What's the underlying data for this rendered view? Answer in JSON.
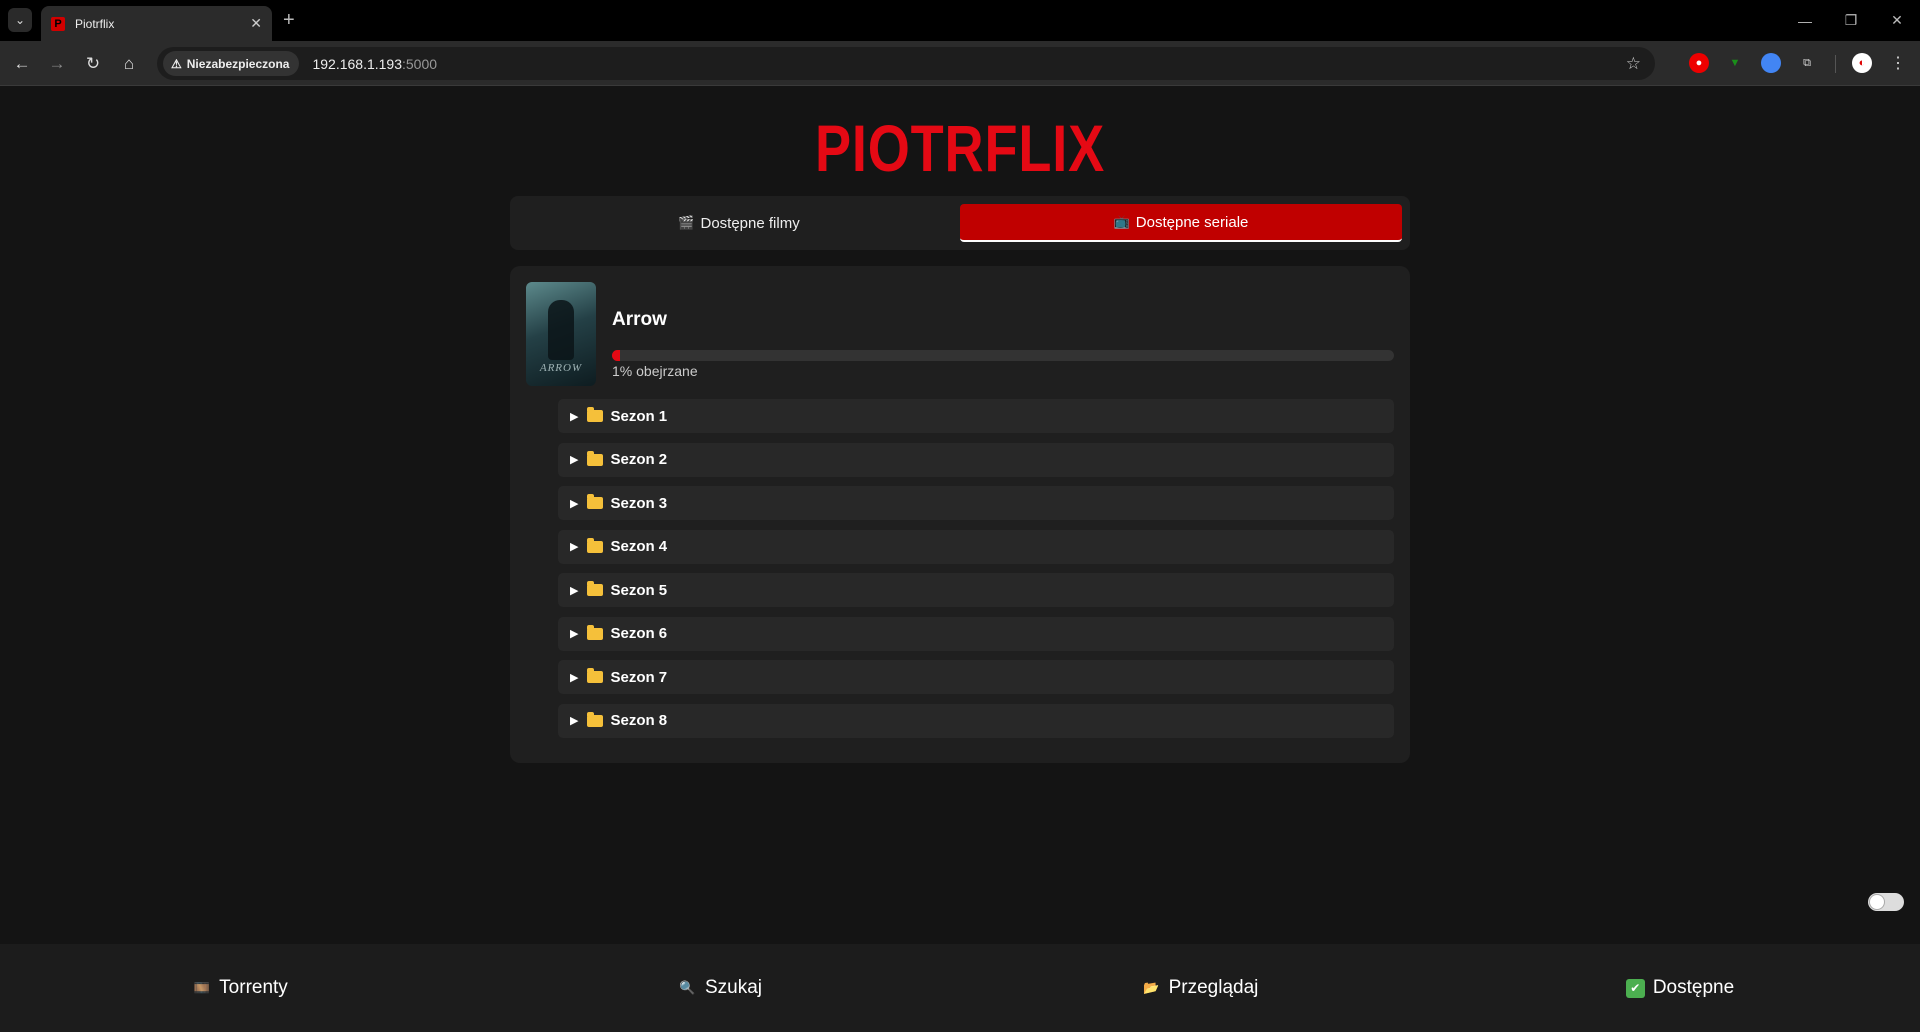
{
  "browser": {
    "tab_title": "Piotrflix",
    "favicon_letter": "P",
    "security_label": "Niezabezpieczona",
    "url_host": "192.168.1.193",
    "url_port": ":5000"
  },
  "logo": "PIOTRFLIX",
  "tabs": [
    {
      "icon": "🎬",
      "label": "Dostępne filmy",
      "active": false
    },
    {
      "icon": "📺",
      "label": "Dostępne seriale",
      "active": true
    }
  ],
  "show": {
    "title": "Arrow",
    "poster_text": "ARROW",
    "progress_percent": 1,
    "progress_label": "1% obejrzane"
  },
  "seasons": [
    "Sezon 1",
    "Sezon 2",
    "Sezon 3",
    "Sezon 4",
    "Sezon 5",
    "Sezon 6",
    "Sezon 7",
    "Sezon 8"
  ],
  "bottom_nav": [
    {
      "icon": "🎞️",
      "label": "Torrenty",
      "color": "#4a90e2"
    },
    {
      "icon": "🔍",
      "label": "Szukaj",
      "color": "#4a90e2"
    },
    {
      "icon": "📂",
      "label": "Przeglądaj",
      "color": "#f5c03a"
    },
    {
      "icon": "✔",
      "label": "Dostępne",
      "color": "#4caf50"
    }
  ],
  "colors": {
    "accent": "#e50914",
    "active_tab": "#c00000"
  }
}
